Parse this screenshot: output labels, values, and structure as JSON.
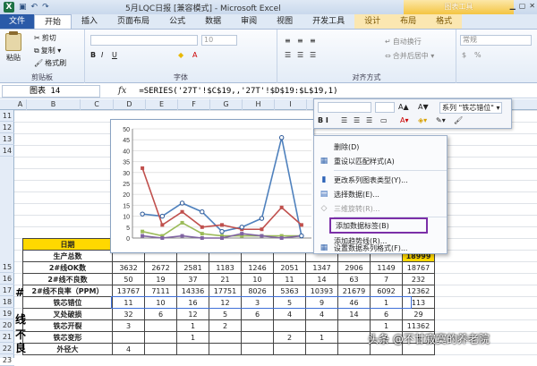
{
  "window": {
    "title": "5月LQC日报 [兼容模式] - Microsoft Excel",
    "context_tools": "图表工具"
  },
  "tabs": [
    "文件",
    "开始",
    "插入",
    "页面布局",
    "公式",
    "数据",
    "审阅",
    "视图",
    "开发工具",
    "设计",
    "布局",
    "格式"
  ],
  "ribbon": {
    "paste": "粘贴",
    "cut": "剪切",
    "copy": "复制 ▾",
    "format_painter": "格式刷",
    "clipboard": "剪贴板",
    "font_group": "字体",
    "align_group": "对齐方式",
    "wrap": "自动换行",
    "merge": "合并后居中 ▾",
    "number_format": "常规",
    "font_size": "10",
    "fx": "fx",
    "pct": "%"
  },
  "formula_bar": {
    "name_box": "图表 14",
    "formula": "=SERIES('27T'!$C$19,,'27T'!$D$19:$L$19,1)"
  },
  "columns": [
    "A",
    "B",
    "C",
    "D",
    "E",
    "F",
    "G",
    "H",
    "I",
    "J",
    "K",
    "L"
  ],
  "rows": [
    "11",
    "12",
    "13",
    "14",
    "15",
    "16",
    "17",
    "18",
    "19",
    "20",
    "21",
    "22",
    "23"
  ],
  "mini_toolbar": {
    "series_label": "系列 \"铁芯错位\" ▾",
    "font": "B I"
  },
  "context_menu": {
    "items": [
      {
        "label": "删除(D)",
        "icon": "delete"
      },
      {
        "label": "重设以匹配样式(A)",
        "icon": "reset"
      },
      {
        "label": "更改系列图表类型(Y)...",
        "icon": "chart-type"
      },
      {
        "label": "选择数据(E)...",
        "icon": "select-data"
      },
      {
        "label": "三维旋转(R)...",
        "icon": "3d"
      },
      {
        "label": "添加数据标签(B)",
        "icon": "label"
      },
      {
        "label": "添加趋势线(R)...",
        "icon": "trend"
      },
      {
        "label": "设置数据系列格式(F)...",
        "icon": "format"
      }
    ]
  },
  "sheet": {
    "header_label": "日期",
    "big_chars": [
      "#",
      "线",
      "不",
      "良"
    ],
    "rows": [
      {
        "label": "生产总数",
        "values": [
          "",
          "",
          "",
          "",
          "",
          "",
          "",
          "",
          ""
        ],
        "total": "18999"
      },
      {
        "label": "2#线OK数",
        "values": [
          "3632",
          "2672",
          "2581",
          "1183",
          "1246",
          "2051",
          "1347",
          "2906",
          "1149"
        ],
        "total": "18767"
      },
      {
        "label": "2#线不良数",
        "values": [
          "50",
          "19",
          "37",
          "21",
          "10",
          "11",
          "14",
          "63",
          "7"
        ],
        "total": "232"
      },
      {
        "label": "2#线不良率（PPM）",
        "values": [
          "13767",
          "7111",
          "14336",
          "17751",
          "8026",
          "5363",
          "10393",
          "21679",
          "6092"
        ],
        "total": "12362"
      },
      {
        "label": "铁芯错位",
        "values": [
          "11",
          "10",
          "16",
          "12",
          "3",
          "5",
          "9",
          "46",
          "1"
        ],
        "total": "113"
      },
      {
        "label": "叉处破损",
        "values": [
          "32",
          "6",
          "12",
          "5",
          "6",
          "4",
          "4",
          "14",
          "6"
        ],
        "total": "29"
      },
      {
        "label": "铁芯开裂",
        "values": [
          "3",
          "",
          "1",
          "2",
          "",
          "",
          "",
          "",
          "1"
        ],
        "total": "11362"
      },
      {
        "label": "铁芯变形",
        "values": [
          "",
          "",
          "1",
          "",
          "",
          "2",
          "1",
          "",
          "1"
        ],
        "total": "1"
      },
      {
        "label": "外径大",
        "values": [
          "4",
          "",
          "",
          "",
          "",
          "",
          "",
          "",
          ""
        ],
        "total": ""
      }
    ]
  },
  "chart_data": {
    "type": "line",
    "ylim": [
      0,
      50
    ],
    "yticks": [
      "0",
      "5",
      "10",
      "15",
      "20",
      "25",
      "30",
      "35",
      "40",
      "45",
      "50"
    ],
    "series": [
      {
        "values": [
          11,
          10,
          16,
          12,
          3,
          5,
          9,
          46,
          1
        ],
        "color": "#4f81bd"
      },
      {
        "values": [
          32,
          6,
          12,
          5,
          6,
          4,
          4,
          14,
          6
        ],
        "color": "#c0504d"
      },
      {
        "values": [
          3,
          1,
          7,
          2,
          1,
          1,
          1,
          1,
          1
        ],
        "color": "#9bbb59"
      },
      {
        "values": [
          1,
          0,
          1,
          0,
          0,
          2,
          1,
          0,
          1
        ],
        "color": "#8064a2"
      }
    ]
  },
  "watermark": "头条 @不甘寂寞的养老院"
}
